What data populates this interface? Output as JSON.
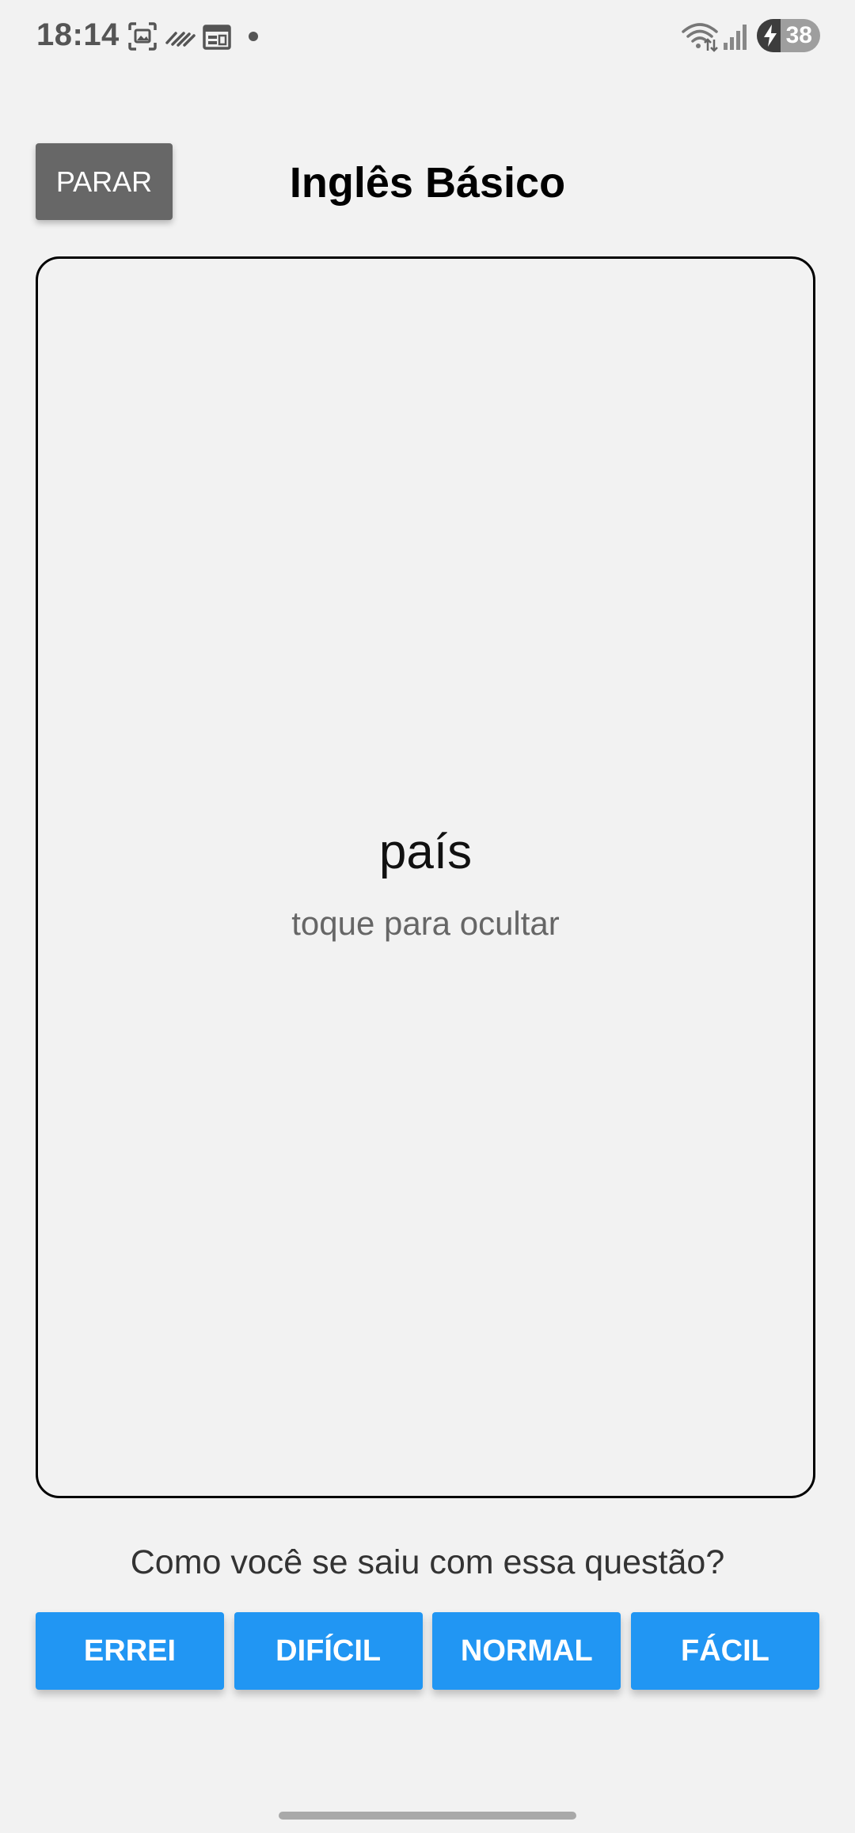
{
  "status_bar": {
    "time": "18:14",
    "battery_level": "38",
    "battery_fraction": 0.38,
    "icons": [
      "screenshot-icon",
      "data-saver-icon",
      "calendar-icon",
      "notification-dot",
      "wifi-icon",
      "signal-icon",
      "battery-charging-icon"
    ]
  },
  "header": {
    "stop_label": "PARAR",
    "title": "Inglês Básico"
  },
  "card": {
    "word": "país",
    "hint": "toque para ocultar"
  },
  "question": {
    "text": "Como você se saiu com essa questão?"
  },
  "ratings": [
    {
      "label": "ERREI"
    },
    {
      "label": "DIFÍCIL"
    },
    {
      "label": "NORMAL"
    },
    {
      "label": "FÁCIL"
    }
  ],
  "colors": {
    "background": "#f2f2f2",
    "stop_button": "#676767",
    "rating_button": "#2196f3",
    "hint_text": "#666666"
  }
}
